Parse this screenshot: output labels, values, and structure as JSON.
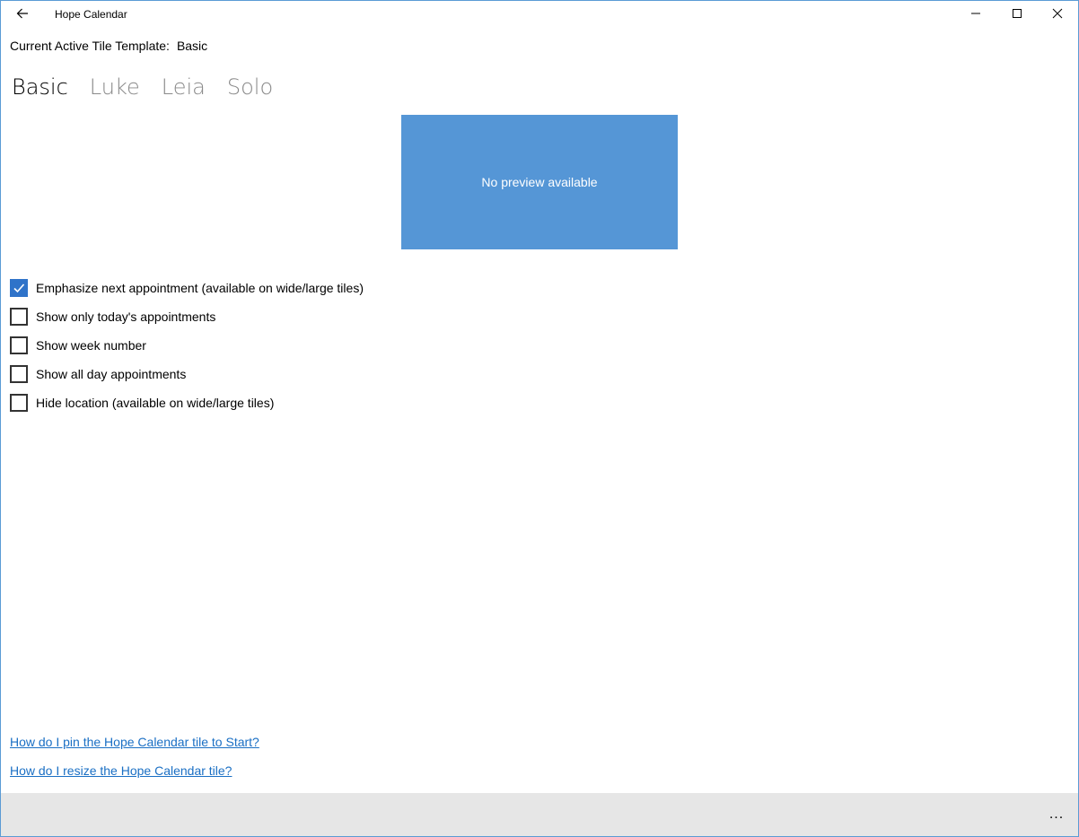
{
  "window": {
    "title": "Hope Calendar",
    "accent_color": "#5b9bd5"
  },
  "header": {
    "active_template_label": "Current Active Tile Template:",
    "active_template_value": "Basic"
  },
  "tabs": [
    {
      "label": "Basic",
      "active": true
    },
    {
      "label": "Luke",
      "active": false
    },
    {
      "label": "Leia",
      "active": false
    },
    {
      "label": "Solo",
      "active": false
    }
  ],
  "preview": {
    "text": "No preview available",
    "color": "#5596d6"
  },
  "options": [
    {
      "label": "Emphasize next appointment (available on wide/large tiles)",
      "checked": true
    },
    {
      "label": "Show only today's appointments",
      "checked": false
    },
    {
      "label": "Show week number",
      "checked": false
    },
    {
      "label": "Show all day appointments",
      "checked": false
    },
    {
      "label": "Hide location (available on wide/large tiles)",
      "checked": false
    }
  ],
  "links": [
    {
      "label": "How do I pin the Hope Calendar tile to Start?"
    },
    {
      "label": "How do I resize the Hope Calendar tile?"
    }
  ],
  "appbar": {
    "more_label": "..."
  },
  "icons": {
    "back": "back-arrow-icon",
    "minimize": "minimize-icon",
    "maximize": "maximize-icon",
    "close": "close-icon",
    "check": "checkmark-icon"
  }
}
